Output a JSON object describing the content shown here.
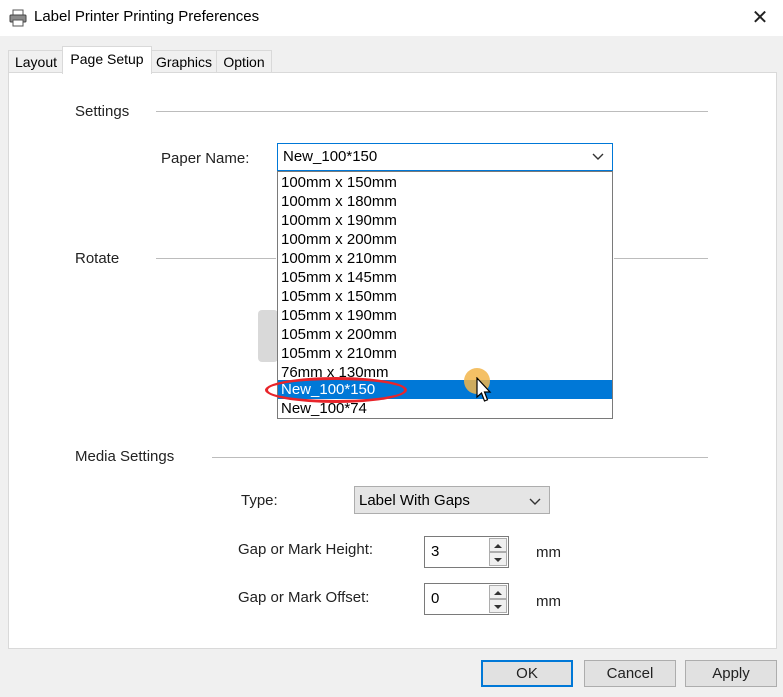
{
  "window": {
    "title": "Label Printer Printing Preferences",
    "close_glyph": "✕"
  },
  "tabs": [
    {
      "label": "Layout"
    },
    {
      "label": "Page Setup"
    },
    {
      "label": "Graphics"
    },
    {
      "label": "Option"
    }
  ],
  "settings": {
    "heading": "Settings",
    "paper_name_label": "Paper Name:",
    "paper_name_value": "New_100*150",
    "paper_options": [
      "100mm x 150mm",
      "100mm x 180mm",
      "100mm x 190mm",
      "100mm x 200mm",
      "100mm x 210mm",
      "105mm x 145mm",
      "105mm x 150mm",
      "105mm x 190mm",
      "105mm x 200mm",
      "105mm x 210mm",
      "76mm x 130mm",
      "New_100*150",
      "New_100*74"
    ],
    "selected_index": 11
  },
  "rotate": {
    "heading": "Rotate"
  },
  "media": {
    "heading": "Media Settings",
    "type_label": "Type:",
    "type_value": "Label With Gaps",
    "gap_height_label": "Gap or Mark Height:",
    "gap_height_value": "3",
    "gap_offset_label": "Gap or Mark Offset:",
    "gap_offset_value": "0",
    "unit": "mm"
  },
  "buttons": {
    "ok": "OK",
    "cancel": "Cancel",
    "apply": "Apply"
  },
  "colors": {
    "accent": "#0078d7",
    "annotation_red": "#e8242a",
    "click_marker": "#f2b54a"
  }
}
